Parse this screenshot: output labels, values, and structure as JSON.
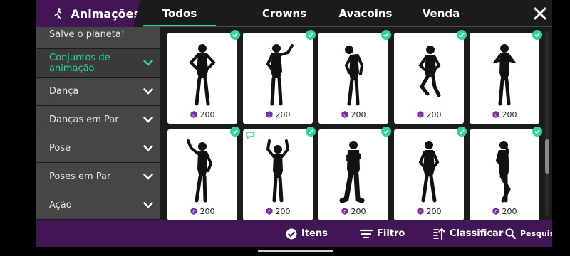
{
  "header": {
    "title": "Animações",
    "tabs": [
      {
        "label": "Todos",
        "active": true
      },
      {
        "label": "Crowns",
        "active": false
      },
      {
        "label": "Avacoins",
        "active": false
      },
      {
        "label": "Venda",
        "active": false
      }
    ]
  },
  "sidebar": {
    "items": [
      {
        "label": "Salve o planeta!",
        "active": false,
        "expandable": false
      },
      {
        "label": "Conjuntos de animação",
        "active": true,
        "expandable": true
      },
      {
        "label": "Dança",
        "active": false,
        "expandable": true
      },
      {
        "label": "Danças em Par",
        "active": false,
        "expandable": true
      },
      {
        "label": "Pose",
        "active": false,
        "expandable": true
      },
      {
        "label": "Poses em Par",
        "active": false,
        "expandable": true
      },
      {
        "label": "Ação",
        "active": false,
        "expandable": true
      }
    ]
  },
  "items": [
    {
      "price": "200",
      "owned": true,
      "pose": "arms-akimbo"
    },
    {
      "price": "200",
      "owned": true,
      "pose": "wave"
    },
    {
      "price": "200",
      "owned": true,
      "pose": "head-tilt"
    },
    {
      "price": "200",
      "owned": true,
      "pose": "kneel"
    },
    {
      "price": "200",
      "owned": true,
      "pose": "hands-chest"
    },
    {
      "price": "200",
      "owned": true,
      "pose": "arm-up"
    },
    {
      "price": "200",
      "owned": true,
      "pose": "arms-raised",
      "chat_badge": true
    },
    {
      "price": "200",
      "owned": true,
      "pose": "crossed-arms"
    },
    {
      "price": "200",
      "owned": true,
      "pose": "hands-hips"
    },
    {
      "price": "200",
      "owned": true,
      "pose": "shy"
    }
  ],
  "footer": {
    "items_label": "Itens",
    "filter_label": "Filtro",
    "sort_label": "Classificar",
    "search_label": "Pesquisa"
  },
  "colors": {
    "accent": "#2fd59a",
    "brand_purple": "#421556",
    "coin_purple": "#7a2f9e"
  }
}
